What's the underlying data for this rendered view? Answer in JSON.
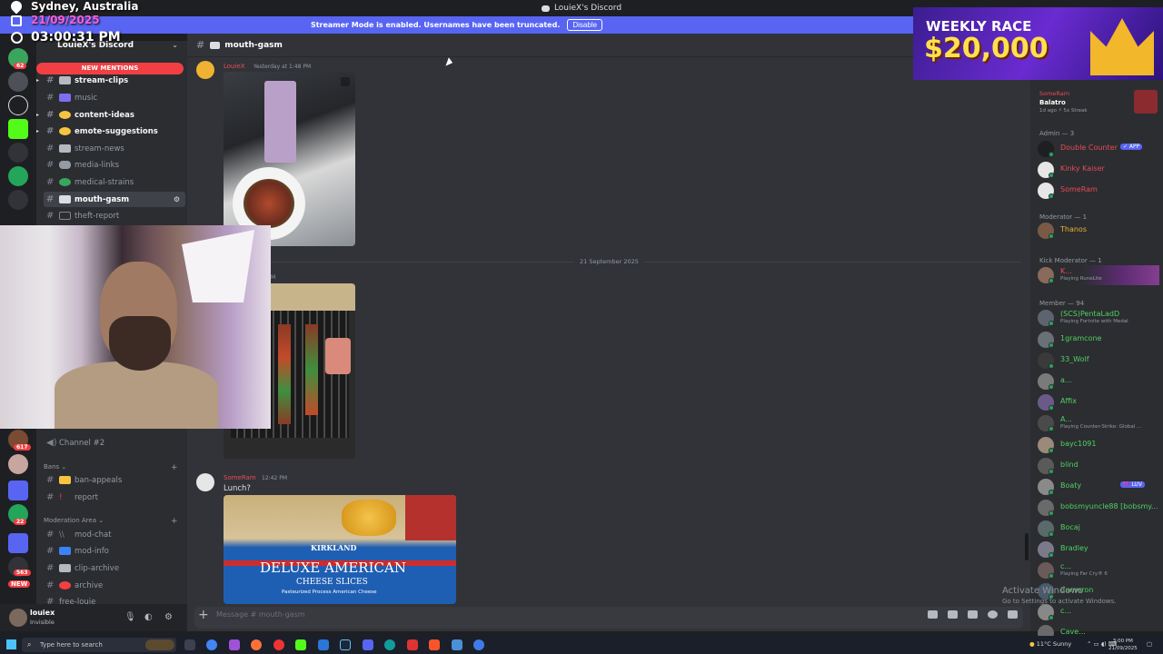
{
  "overlay": {
    "city": "Sydney, Australia",
    "date": "21/09/2025",
    "time": "03:00:31 PM"
  },
  "window": {
    "title": "LouieX's Discord"
  },
  "banner": {
    "text": "Streamer Mode is enabled. Usernames have been truncated.",
    "disable_label": "Disable"
  },
  "rail": {
    "badges": [
      "62",
      "617",
      "563",
      "22"
    ],
    "new_label": "NEW"
  },
  "sidebar": {
    "server_name": "LouieX's Discord",
    "new_mentions_label": "NEW MENTIONS",
    "channels": [
      {
        "label": "stream-clips",
        "unread": true,
        "emoji_color": "#b5bac1"
      },
      {
        "label": "music",
        "unread": false,
        "emoji_color": "#7f6df2"
      },
      {
        "label": "content-ideas",
        "unread": true,
        "emoji_color": "#f5c542"
      },
      {
        "label": "emote-suggestions",
        "unread": true,
        "emoji_color": "#f5c542"
      },
      {
        "label": "stream-news",
        "unread": false,
        "emoji_color": "#b5bac1"
      },
      {
        "label": "media-links",
        "unread": false,
        "emoji_color": "#b5bac1"
      },
      {
        "label": "medical-strains",
        "unread": false,
        "emoji_color": "#3ba55d"
      },
      {
        "label": "mouth-gasm",
        "unread": false,
        "emoji_color": "#dbdee1"
      },
      {
        "label": "theft-report",
        "unread": false,
        "emoji_color": "#80848e"
      }
    ],
    "voice_channel": "Channel #2",
    "categories": [
      {
        "label": "Bans",
        "channels": [
          "ban-appeals",
          "report"
        ]
      },
      {
        "label": "Moderation Area",
        "channels": [
          "mod-chat",
          "mod-info",
          "clip-archive",
          "archive",
          "free-louie"
        ]
      }
    ]
  },
  "main": {
    "channel": "mouth-gasm",
    "date_divider": "21 September 2025",
    "messages": [
      {
        "author": "LouieX",
        "timestamp": "Yesterday at 1:48 PM",
        "text": ""
      },
      {
        "author": "",
        "timestamp": "M",
        "text": ""
      },
      {
        "author": "SomeRam",
        "timestamp": "12:42 PM",
        "text": "Lunch?"
      }
    ],
    "package_text": {
      "brand": "KIRKLAND",
      "title": "DELUXE AMERICAN",
      "subtitle": "CHEESE SLICES",
      "detail": "Pasteurized Process American Cheese"
    },
    "composer_placeholder": "Message #",
    "composer_channel": "mouth-gasm"
  },
  "user_panel": {
    "name": "louiex",
    "status": "Invisible"
  },
  "members": {
    "activity": {
      "name": "SomeRam",
      "game": "Balatro",
      "meta": "1d ago  ⚡ 5x Streak"
    },
    "groups": [
      {
        "label": "Admin — 3",
        "members": [
          {
            "name": "Double Counter",
            "tag": "✓ APP",
            "activity": "",
            "color": "#e94b55"
          },
          {
            "name": "Kinky Kaiser",
            "tag": "",
            "activity": "",
            "color": "#e94b55"
          },
          {
            "name": "SomeRam",
            "tag": "",
            "activity": "",
            "color": "#e94b55"
          }
        ]
      },
      {
        "label": "Moderator — 1",
        "members": [
          {
            "name": "Thanos",
            "tag": "",
            "activity": "",
            "color": "#f0b232"
          }
        ]
      },
      {
        "label": "Kick Moderator — 1",
        "members": [
          {
            "name": "K...",
            "tag": "",
            "activity": "Playing RuneLite",
            "color": "#e94b55"
          }
        ]
      },
      {
        "label": "Member — 94",
        "members": [
          {
            "name": "(SCS)PentaLadD",
            "activity": "Playing Fortnite with Medal",
            "color": "#4fd160"
          },
          {
            "name": "1gramcone",
            "activity": "",
            "color": "#4fd160"
          },
          {
            "name": "33_Wolf",
            "activity": "",
            "color": "#4fd160"
          },
          {
            "name": "a...",
            "activity": "",
            "color": "#4fd160"
          },
          {
            "name": "Affix",
            "activity": "",
            "color": "#4fd160"
          },
          {
            "name": "A...",
            "activity": "Playing Counter-Strike: Global ...",
            "color": "#4fd160"
          },
          {
            "name": "bayc1091",
            "activity": "",
            "color": "#4fd160"
          },
          {
            "name": "blind",
            "activity": "",
            "color": "#4fd160"
          },
          {
            "name": "Boaty",
            "tag": "💜 LUV",
            "activity": "",
            "color": "#4fd160"
          },
          {
            "name": "bobsmyuncle88 [bobsmy...",
            "activity": "",
            "color": "#4fd160"
          },
          {
            "name": "Bocaj",
            "activity": "",
            "color": "#4fd160"
          },
          {
            "name": "Bradley",
            "activity": "",
            "color": "#4fd160"
          },
          {
            "name": "c...",
            "activity": "Playing Far Cry® 6",
            "color": "#4fd160"
          },
          {
            "name": "Cameron",
            "activity": "",
            "color": "#4fd160"
          },
          {
            "name": "c...",
            "activity": "",
            "color": "#4fd160"
          },
          {
            "name": "Cave...",
            "activity": "",
            "color": "#4fd160"
          }
        ]
      }
    ]
  },
  "promo": {
    "line1": "WEEKLY RACE",
    "line2": "$20,000"
  },
  "watermark": {
    "title": "Activate Windows",
    "subtitle": "Go to Settings to activate Windows."
  },
  "taskbar": {
    "search_placeholder": "Type here to search",
    "weather": "11°C  Sunny",
    "time": "3:00 PM",
    "date": "21/09/2025"
  }
}
